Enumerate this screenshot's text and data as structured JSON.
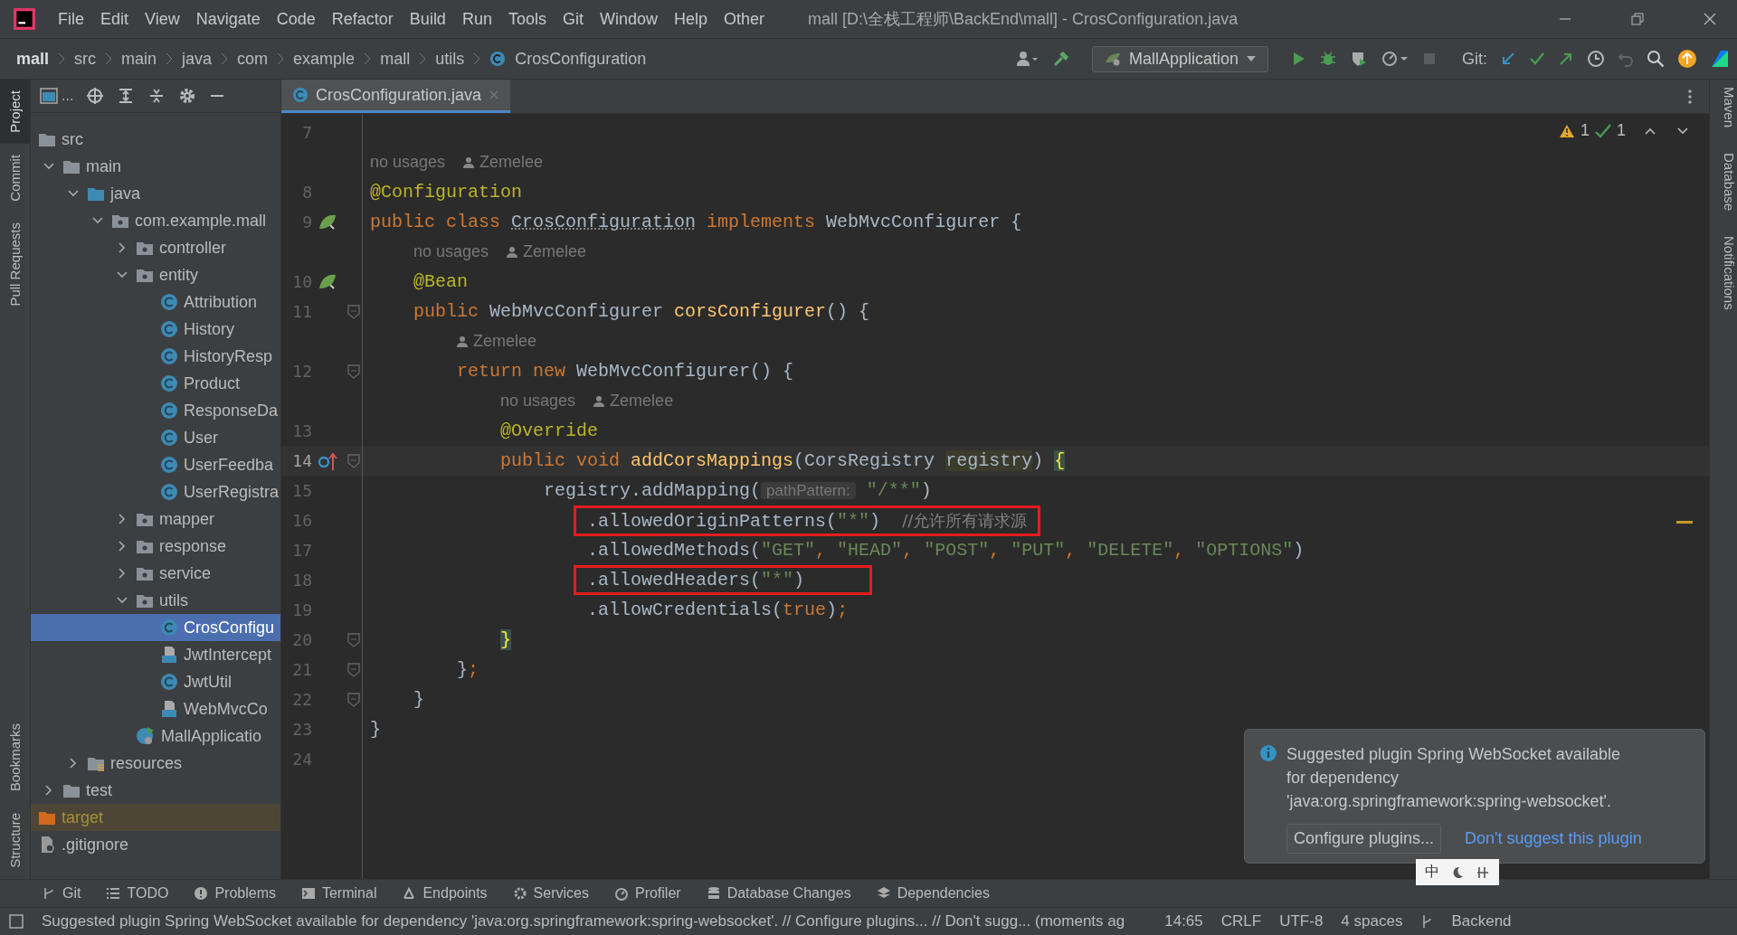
{
  "title_bar": {
    "menus": [
      "File",
      "Edit",
      "View",
      "Navigate",
      "Code",
      "Refactor",
      "Build",
      "Run",
      "Tools",
      "Git",
      "Window",
      "Help",
      "Other"
    ],
    "title": "mall [D:\\全栈工程师\\BackEnd\\mall] - CrosConfiguration.java"
  },
  "nav_bar": {
    "breadcrumbs": [
      "mall",
      "src",
      "main",
      "java",
      "com",
      "example",
      "mall",
      "utils"
    ],
    "current_file": "CrosConfiguration",
    "run_config": "MallApplication",
    "git_label": "Git:"
  },
  "left_strip": [
    {
      "label": "Project",
      "selected": true
    },
    {
      "label": "Commit",
      "selected": false
    },
    {
      "label": "Pull Requests",
      "selected": false
    },
    {
      "label": "Bookmarks",
      "selected": false
    },
    {
      "label": "Structure",
      "selected": false
    }
  ],
  "right_strip": [
    {
      "label": "Maven"
    },
    {
      "label": "Database"
    },
    {
      "label": "Notifications"
    }
  ],
  "project": {
    "toolbar_label": "...",
    "tree": [
      {
        "label": "src",
        "kind": "folder",
        "children": [
          {
            "label": "main",
            "kind": "folder",
            "expanded": true,
            "children": [
              {
                "label": "java",
                "kind": "source",
                "expanded": true,
                "children": [
                  {
                    "label": "com.example.mall",
                    "kind": "package",
                    "expanded": true,
                    "children": [
                      {
                        "label": "controller",
                        "kind": "package",
                        "expanded": false
                      },
                      {
                        "label": "entity",
                        "kind": "package",
                        "expanded": true,
                        "children": [
                          {
                            "label": "Attribution",
                            "kind": "class",
                            "selected": false
                          },
                          {
                            "label": "History",
                            "kind": "class",
                            "selected": false
                          },
                          {
                            "label": "HistoryResp",
                            "kind": "class",
                            "selected": false
                          },
                          {
                            "label": "Product",
                            "kind": "class",
                            "selected": false
                          },
                          {
                            "label": "ResponseDa",
                            "kind": "class",
                            "selected": false
                          },
                          {
                            "label": "User",
                            "kind": "class",
                            "selected": false
                          },
                          {
                            "label": "UserFeedba",
                            "kind": "class",
                            "selected": false
                          },
                          {
                            "label": "UserRegistra",
                            "kind": "class",
                            "selected": false
                          }
                        ]
                      },
                      {
                        "label": "mapper",
                        "kind": "package",
                        "expanded": false
                      },
                      {
                        "label": "response",
                        "kind": "package",
                        "expanded": false
                      },
                      {
                        "label": "service",
                        "kind": "package",
                        "expanded": false
                      },
                      {
                        "label": "utils",
                        "kind": "package",
                        "expanded": true,
                        "children": [
                          {
                            "label": "CrosConfigu",
                            "kind": "class",
                            "selected": true
                          },
                          {
                            "label": "JwtIntercept",
                            "kind": "interface",
                            "selected": false
                          },
                          {
                            "label": "JwtUtil",
                            "kind": "class",
                            "selected": false
                          },
                          {
                            "label": "WebMvcCo",
                            "kind": "interface",
                            "selected": false
                          }
                        ]
                      },
                      {
                        "label": "MallApplicatio",
                        "kind": "app",
                        "selected": false
                      }
                    ]
                  }
                ]
              },
              {
                "label": "resources",
                "kind": "resources",
                "expanded": false
              }
            ]
          },
          {
            "label": "test",
            "kind": "folder",
            "expanded": false
          }
        ]
      },
      {
        "label": "target",
        "kind": "excluded"
      },
      {
        "label": ".gitignore",
        "kind": "file"
      }
    ]
  },
  "editor": {
    "tab": "CrosConfiguration.java",
    "warnings": "1",
    "checks": "1",
    "lines": [
      {
        "kind": "code",
        "number": "7"
      },
      {
        "kind": "hint",
        "usages": "no usages",
        "author": "Zemelee"
      },
      {
        "kind": "code",
        "number": "8",
        "tokens": [
          {
            "kind": "annotation",
            "text": "@Configuration"
          }
        ]
      },
      {
        "kind": "code",
        "number": "9",
        "gutter": {
          "kind": "bean"
        },
        "tokens": [
          {
            "kind": "keyword",
            "text": "public class "
          },
          {
            "kind": "class_name",
            "text": "CrosConfiguration"
          },
          {
            "kind": "keyword",
            "text": " implements "
          },
          {
            "kind": "plain",
            "text": "WebMvcConfigurer {"
          }
        ]
      },
      {
        "kind": "hint",
        "usages": "    no usages",
        "author": "Zemelee"
      },
      {
        "kind": "code",
        "number": "10",
        "gutter": {
          "kind": "bean"
        },
        "tokens": [
          {
            "kind": "annotation",
            "text": "    @Bean"
          }
        ]
      },
      {
        "kind": "code",
        "number": "11",
        "fold": true,
        "tokens": [
          {
            "kind": "keyword",
            "text": "    public "
          },
          {
            "kind": "plain",
            "text": "WebMvcConfigurer "
          },
          {
            "kind": "method",
            "text": "corsConfigurer"
          },
          {
            "kind": "plain",
            "text": "() {"
          }
        ]
      },
      {
        "kind": "hint",
        "author": "        Zemelee"
      },
      {
        "kind": "code",
        "number": "12",
        "fold": true,
        "tokens": [
          {
            "kind": "keyword",
            "text": "        return new "
          },
          {
            "kind": "plain",
            "text": "WebMvcConfigurer() {"
          }
        ]
      },
      {
        "kind": "hint",
        "usages": "            no usages",
        "author": "Zemelee"
      },
      {
        "kind": "code",
        "number": "13",
        "tokens": [
          {
            "kind": "annotation",
            "text": "            @Override"
          }
        ]
      },
      {
        "kind": "code",
        "number": "14",
        "gutter": {
          "kind": "override"
        },
        "fold": true,
        "current": true,
        "tokens": [
          {
            "kind": "keyword",
            "text": "            public void "
          },
          {
            "kind": "method",
            "text": "addCorsMappings"
          },
          {
            "kind": "plain",
            "text": "(CorsRegistry "
          },
          {
            "kind": "usage",
            "text": "registry"
          },
          {
            "kind": "plain",
            "text": ") "
          },
          {
            "kind": "brace",
            "text": "{"
          }
        ]
      },
      {
        "kind": "code",
        "number": "15",
        "tokens": [
          {
            "kind": "plain",
            "text": "                registry.addMapping("
          },
          {
            "kind": "param_hint",
            "text": "pathPattern:"
          },
          {
            "kind": "string",
            "text": " \"/**\""
          },
          {
            "kind": "plain",
            "text": ")"
          }
        ]
      },
      {
        "kind": "code",
        "number": "16",
        "boxed": true,
        "tokens": [
          {
            "kind": "plain",
            "text": "                    .allowedOriginPatterns("
          },
          {
            "kind": "string",
            "text": "\"*\""
          },
          {
            "kind": "plain",
            "text": ")  "
          },
          {
            "kind": "comment",
            "text": "//允许所有请求源"
          }
        ]
      },
      {
        "kind": "code",
        "number": "17",
        "tokens": [
          {
            "kind": "plain",
            "text": "                    .allowedMethods("
          },
          {
            "kind": "string",
            "text": "\"GET\""
          },
          {
            "kind": "keyword",
            "text": ", "
          },
          {
            "kind": "string",
            "text": "\"HEAD\""
          },
          {
            "kind": "keyword",
            "text": ", "
          },
          {
            "kind": "string",
            "text": "\"POST\""
          },
          {
            "kind": "keyword",
            "text": ", "
          },
          {
            "kind": "string",
            "text": "\"PUT\""
          },
          {
            "kind": "keyword",
            "text": ", "
          },
          {
            "kind": "string",
            "text": "\"DELETE\""
          },
          {
            "kind": "keyword",
            "text": ", "
          },
          {
            "kind": "string",
            "text": "\"OPTIONS\""
          },
          {
            "kind": "plain",
            "text": ")"
          }
        ]
      },
      {
        "kind": "code",
        "number": "18",
        "boxed": true,
        "tokens": [
          {
            "kind": "plain",
            "text": "                    .allowedHeaders("
          },
          {
            "kind": "string",
            "text": "\"*\""
          },
          {
            "kind": "plain",
            "text": ")     "
          }
        ]
      },
      {
        "kind": "code",
        "number": "19",
        "tokens": [
          {
            "kind": "plain",
            "text": "                    .allowCredentials("
          },
          {
            "kind": "keyword",
            "text": "true"
          },
          {
            "kind": "plain",
            "text": ")"
          },
          {
            "kind": "keyword",
            "text": ";"
          }
        ]
      },
      {
        "kind": "code",
        "number": "20",
        "fold": true,
        "tokens": [
          {
            "kind": "brace",
            "text": "            }"
          }
        ]
      },
      {
        "kind": "code",
        "number": "21",
        "fold": true,
        "tokens": [
          {
            "kind": "plain",
            "text": "        }"
          },
          {
            "kind": "keyword",
            "text": ";"
          }
        ]
      },
      {
        "kind": "code",
        "number": "22",
        "fold": true,
        "tokens": [
          {
            "kind": "plain",
            "text": "    }"
          }
        ]
      },
      {
        "kind": "code",
        "number": "23",
        "tokens": [
          {
            "kind": "plain",
            "text": "}"
          }
        ]
      },
      {
        "kind": "code",
        "number": "24"
      }
    ]
  },
  "notification": {
    "message": "Suggested plugin Spring WebSocket available for dependency 'java:org.springframework:spring-websocket'.",
    "button": "Configure plugins...",
    "link": "Don't suggest this plugin"
  },
  "ime_bar": {
    "label": "中"
  },
  "tool_windows": [
    {
      "label": "Git"
    },
    {
      "label": "TODO"
    },
    {
      "label": "Problems"
    },
    {
      "label": "Terminal"
    },
    {
      "label": "Endpoints"
    },
    {
      "label": "Services"
    },
    {
      "label": "Profiler"
    },
    {
      "label": "Database Changes"
    },
    {
      "label": "Dependencies"
    }
  ],
  "status_bar": {
    "message": "Suggested plugin Spring WebSocket available for dependency 'java:org.springframework:spring-websocket'. // Configure plugins... // Don't sugg... (moments ag",
    "items": [
      "14:65",
      "CRLF",
      "UTF-8",
      "4 spaces"
    ],
    "branch": "Backend"
  }
}
